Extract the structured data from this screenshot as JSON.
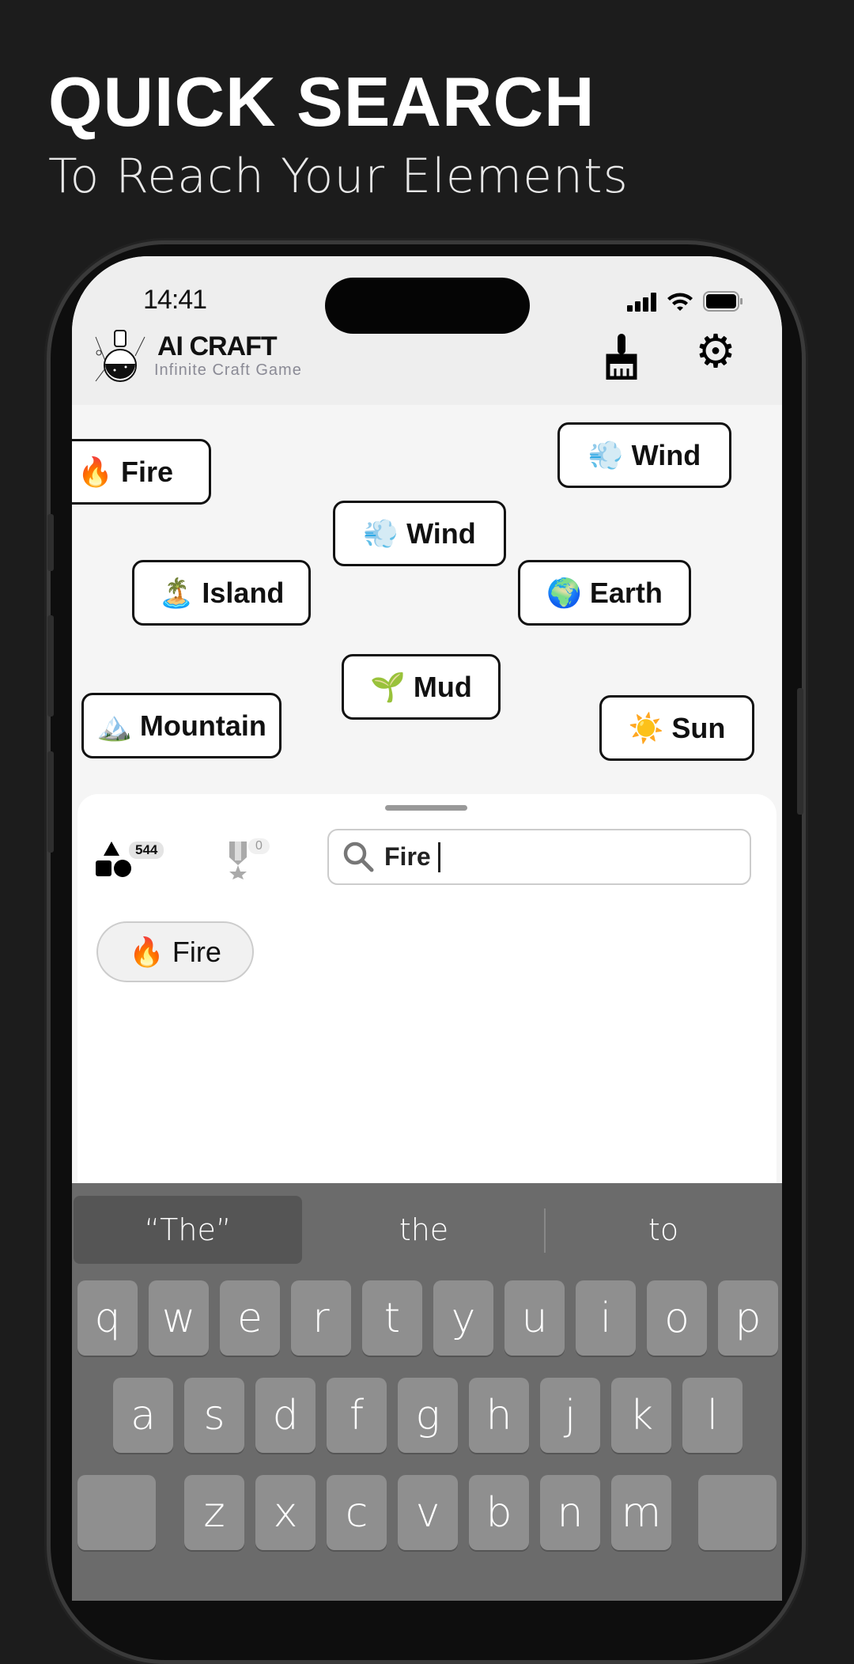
{
  "promo": {
    "title": "QUICK SEARCH",
    "subtitle": "To Reach Your Elements"
  },
  "status_bar": {
    "time": "14:41"
  },
  "header": {
    "app_name": "AI CRAFT",
    "tagline": "Infinite Craft Game",
    "icons": [
      "flask-logo",
      "brush-icon",
      "gear-icon"
    ]
  },
  "canvas": {
    "elements": [
      {
        "emoji": "🔥",
        "label": "Fire"
      },
      {
        "emoji": "💨",
        "label": "Wind"
      },
      {
        "emoji": "💨",
        "label": "Wind"
      },
      {
        "emoji": "🏝️",
        "label": "Island"
      },
      {
        "emoji": "🌍",
        "label": "Earth"
      },
      {
        "emoji": "🌱",
        "label": "Mud"
      },
      {
        "emoji": "🏔️",
        "label": "Mountain"
      },
      {
        "emoji": "☀️",
        "label": "Sun"
      }
    ]
  },
  "sheet": {
    "elements_count": "544",
    "achievements_count": "0",
    "search": {
      "value": "Fire "
    },
    "results": [
      {
        "emoji": "🔥",
        "label": "Fire"
      }
    ]
  },
  "keyboard": {
    "suggestions": [
      "“The”",
      "the",
      "to"
    ],
    "row1": [
      "q",
      "w",
      "e",
      "r",
      "t",
      "y",
      "u",
      "i",
      "o",
      "p"
    ],
    "row2": [
      "a",
      "s",
      "d",
      "f",
      "g",
      "h",
      "j",
      "k",
      "l"
    ],
    "row3": [
      "z",
      "x",
      "c",
      "v",
      "b",
      "n",
      "m"
    ]
  }
}
